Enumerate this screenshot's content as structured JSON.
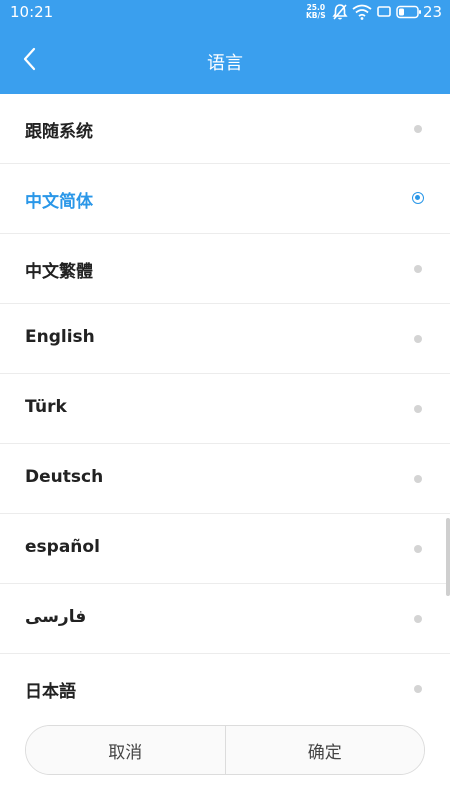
{
  "status_bar": {
    "time": "10:21",
    "net_speed_value": "25.0",
    "net_speed_unit": "KB/S",
    "battery_level": "23",
    "icons": [
      "mute-bell-icon",
      "wifi-icon",
      "screen-icon",
      "battery-icon"
    ]
  },
  "header": {
    "title": "语言",
    "back_icon": "chevron-left-icon",
    "background_color": "#3a9fee"
  },
  "languages": [
    {
      "label": "跟随系统",
      "selected": false
    },
    {
      "label": "中文简体",
      "selected": true
    },
    {
      "label": "中文繁體",
      "selected": false
    },
    {
      "label": "English",
      "selected": false
    },
    {
      "label": "Türk",
      "selected": false
    },
    {
      "label": "Deutsch",
      "selected": false
    },
    {
      "label": "español",
      "selected": false
    },
    {
      "label": "فارسی",
      "selected": false
    },
    {
      "label": "日本語",
      "selected": false
    }
  ],
  "colors": {
    "accent": "#2a97e8",
    "text": "#222222",
    "radio_idle": "#d4d4d4"
  },
  "footer": {
    "cancel_label": "取消",
    "confirm_label": "确定"
  }
}
